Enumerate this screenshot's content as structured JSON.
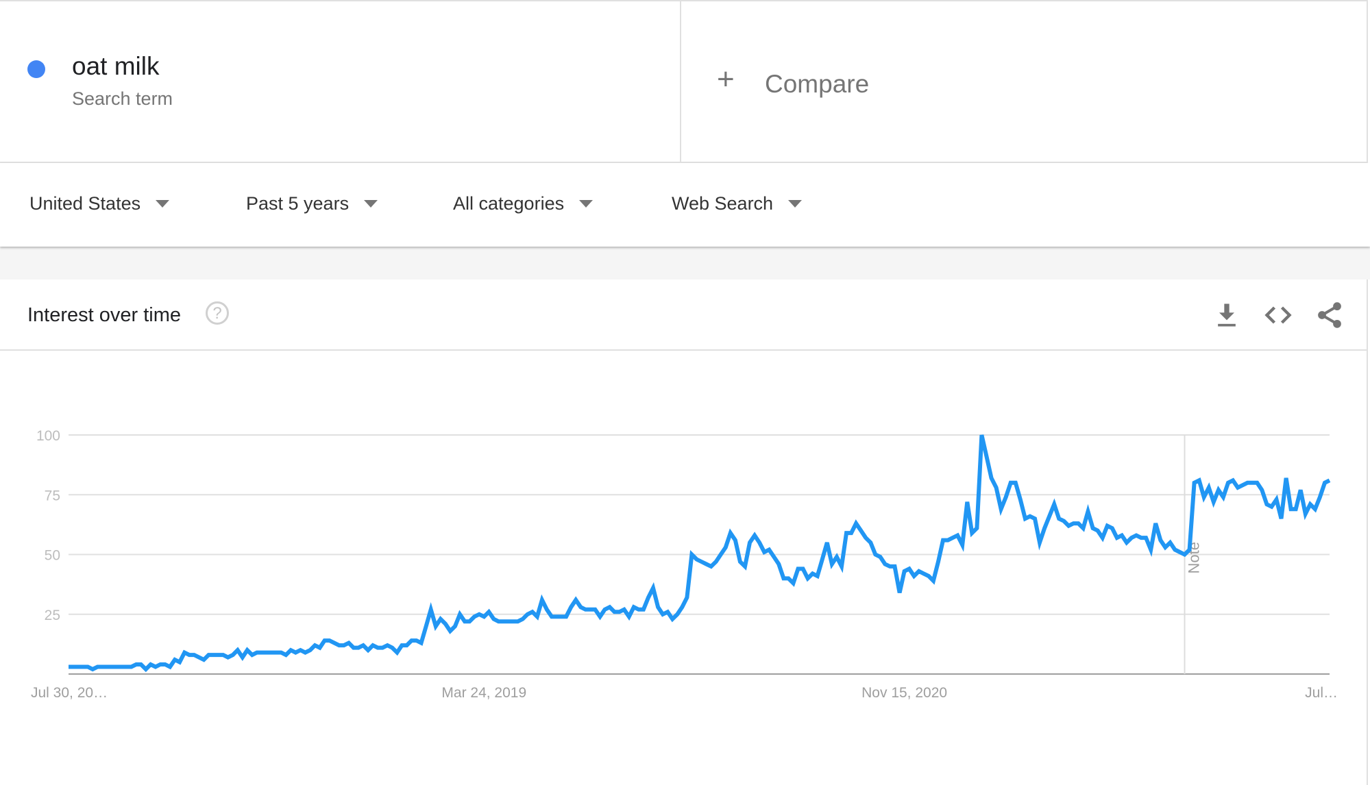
{
  "search_term": {
    "name": "oat milk",
    "type_label": "Search term",
    "color": "#4285f4"
  },
  "compare": {
    "icon": "plus-icon",
    "label": "Compare"
  },
  "filters": [
    {
      "label": "United States",
      "icon": "caret-down-icon"
    },
    {
      "label": "Past 5 years",
      "icon": "caret-down-icon"
    },
    {
      "label": "All categories",
      "icon": "caret-down-icon"
    },
    {
      "label": "Web Search",
      "icon": "caret-down-icon"
    }
  ],
  "panel": {
    "title": "Interest over time",
    "help_icon": "help-circle-icon",
    "help_glyph": "?",
    "actions": [
      "download-icon",
      "embed-code-icon",
      "share-icon"
    ]
  },
  "chart_data": {
    "type": "line",
    "title": "Interest over time",
    "xlabel": "",
    "ylabel": "",
    "ylim": [
      0,
      100
    ],
    "yticks": [
      25,
      50,
      75,
      100
    ],
    "grid": true,
    "line_color": "#2196f3",
    "x_tick_labels": [
      {
        "label": "Jul 30, 20…",
        "week_index": 0
      },
      {
        "label": "Mar 24, 2019",
        "week_index": 86
      },
      {
        "label": "Nov 15, 2020",
        "week_index": 173
      },
      {
        "label": "Jul…",
        "week_index": 260
      }
    ],
    "annotations": [
      {
        "label": "Note",
        "week_index": 231
      }
    ],
    "series": [
      {
        "name": "oat milk",
        "values": [
          3,
          3,
          3,
          3,
          3,
          2,
          3,
          3,
          3,
          3,
          3,
          3,
          3,
          3,
          4,
          4,
          2,
          4,
          3,
          4,
          4,
          3,
          6,
          5,
          9,
          8,
          8,
          7,
          6,
          8,
          8,
          8,
          8,
          7,
          8,
          10,
          7,
          10,
          8,
          9,
          9,
          9,
          9,
          9,
          9,
          8,
          10,
          9,
          10,
          9,
          10,
          12,
          11,
          14,
          14,
          13,
          12,
          12,
          13,
          11,
          11,
          12,
          10,
          12,
          11,
          11,
          12,
          11,
          9,
          12,
          12,
          14,
          14,
          13,
          20,
          27,
          20,
          23,
          21,
          18,
          20,
          25,
          22,
          22,
          24,
          25,
          24,
          26,
          23,
          22,
          22,
          22,
          22,
          22,
          23,
          25,
          26,
          24,
          31,
          27,
          24,
          24,
          24,
          24,
          28,
          31,
          28,
          27,
          27,
          27,
          24,
          27,
          28,
          26,
          26,
          27,
          24,
          28,
          27,
          27,
          32,
          36,
          28,
          25,
          26,
          23,
          25,
          28,
          32,
          50,
          48,
          47,
          46,
          45,
          47,
          50,
          53,
          59,
          56,
          47,
          45,
          55,
          58,
          55,
          51,
          52,
          49,
          46,
          40,
          40,
          38,
          44,
          44,
          40,
          42,
          41,
          48,
          55,
          46,
          49,
          45,
          59,
          59,
          63,
          60,
          57,
          55,
          50,
          49,
          46,
          45,
          45,
          34,
          43,
          44,
          41,
          43,
          42,
          41,
          39,
          47,
          56,
          56,
          57,
          58,
          54,
          72,
          59,
          61,
          100,
          91,
          82,
          78,
          69,
          74,
          80,
          80,
          73,
          65,
          66,
          65,
          55,
          61,
          66,
          71,
          65,
          64,
          62,
          63,
          63,
          61,
          68,
          61,
          60,
          57,
          62,
          61,
          57,
          58,
          55,
          57,
          58,
          57,
          57,
          52,
          63,
          56,
          53,
          55,
          52,
          51,
          50,
          52,
          80,
          81,
          74,
          78,
          72,
          77,
          74,
          80,
          81,
          78,
          79,
          80,
          80,
          80,
          77,
          71,
          70,
          73,
          65,
          82,
          69,
          69,
          77,
          67,
          71,
          69,
          74,
          80,
          81
        ]
      }
    ]
  }
}
